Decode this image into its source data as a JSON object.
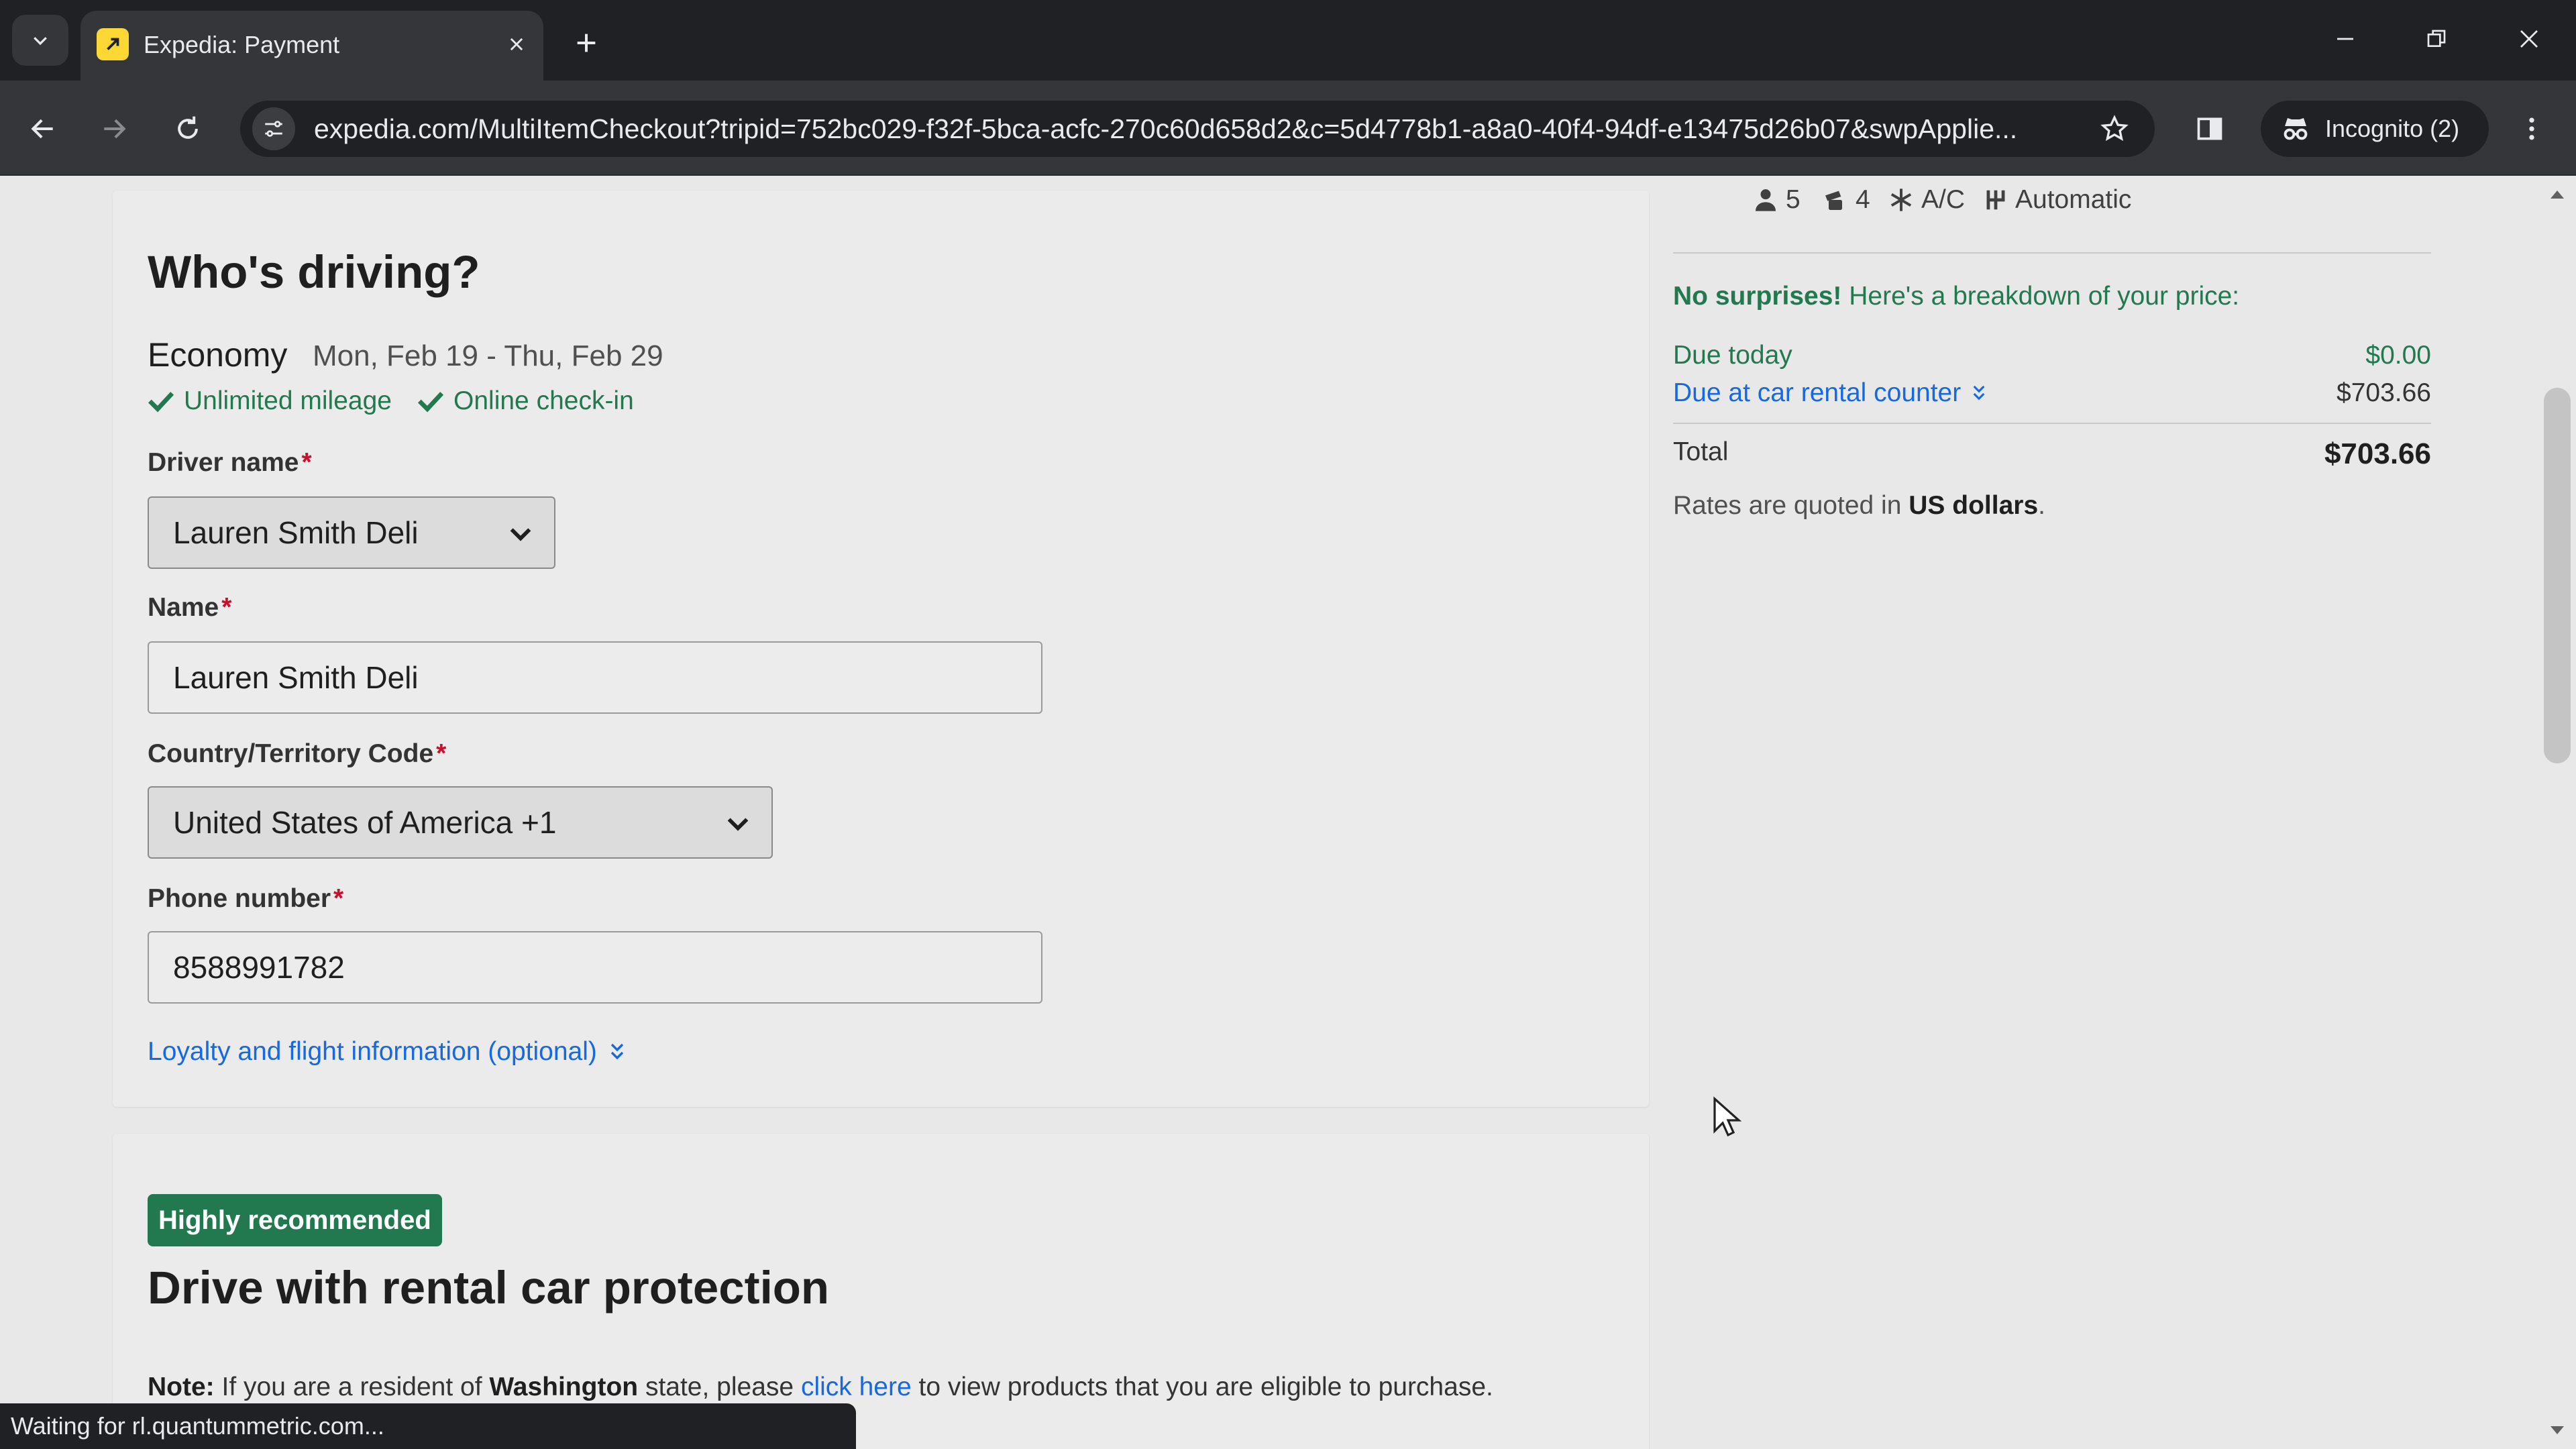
{
  "browser": {
    "tab_title": "Expedia: Payment",
    "url": "expedia.com/MultiItemCheckout?tripid=752bc029-f32f-5bca-acfc-270c60d658d2&c=5d4778b1-a8a0-40f4-94df-e13475d26b07&swpApplie...",
    "incognito_label": "Incognito (2)",
    "status_text": "Waiting for rl.quantummetric.com...",
    "favicon_color": "#fdd835"
  },
  "driver_section": {
    "title": "Who's driving?",
    "car_class": "Economy",
    "dates": "Mon, Feb 19 - Thu, Feb 29",
    "features": [
      "Unlimited mileage",
      "Online check-in"
    ],
    "driver_name": {
      "label": "Driver name",
      "required_mark": "*",
      "value": "Lauren Smith Deli"
    },
    "name": {
      "label": "Name",
      "required_mark": "*",
      "value": "Lauren Smith Deli"
    },
    "country_code": {
      "label": "Country/Territory Code",
      "required_mark": "*",
      "value": "United States of America +1"
    },
    "phone": {
      "label": "Phone number",
      "required_mark": "*",
      "value": "8588991782"
    },
    "loyalty_link": "Loyalty and flight information (optional)"
  },
  "protection_section": {
    "badge": "Highly recommended",
    "title": "Drive with rental car protection",
    "note_label": "Note:",
    "note_pre": "If you are a resident of",
    "note_state": "Washington",
    "note_mid": "state, please",
    "note_link": "click here",
    "note_post": "to view products that you are eligible to purchase."
  },
  "sidebar": {
    "specs": {
      "passengers": "5",
      "bags": "4",
      "ac": "A/C",
      "transmission": "Automatic"
    },
    "no_surprises_bold": "No surprises!",
    "no_surprises_text": "Here's a breakdown of your price:",
    "due_today_label": "Due today",
    "due_today_value": "$0.00",
    "due_counter_label": "Due at car rental counter",
    "due_counter_value": "$703.66",
    "total_label": "Total",
    "total_value": "$703.66",
    "rates_pre": "Rates are quoted in",
    "rates_currency": "US dollars",
    "rates_post": "."
  },
  "colors": {
    "accent_green": "#227950",
    "link_blue": "#1668e3",
    "required_red": "#c8102e"
  }
}
